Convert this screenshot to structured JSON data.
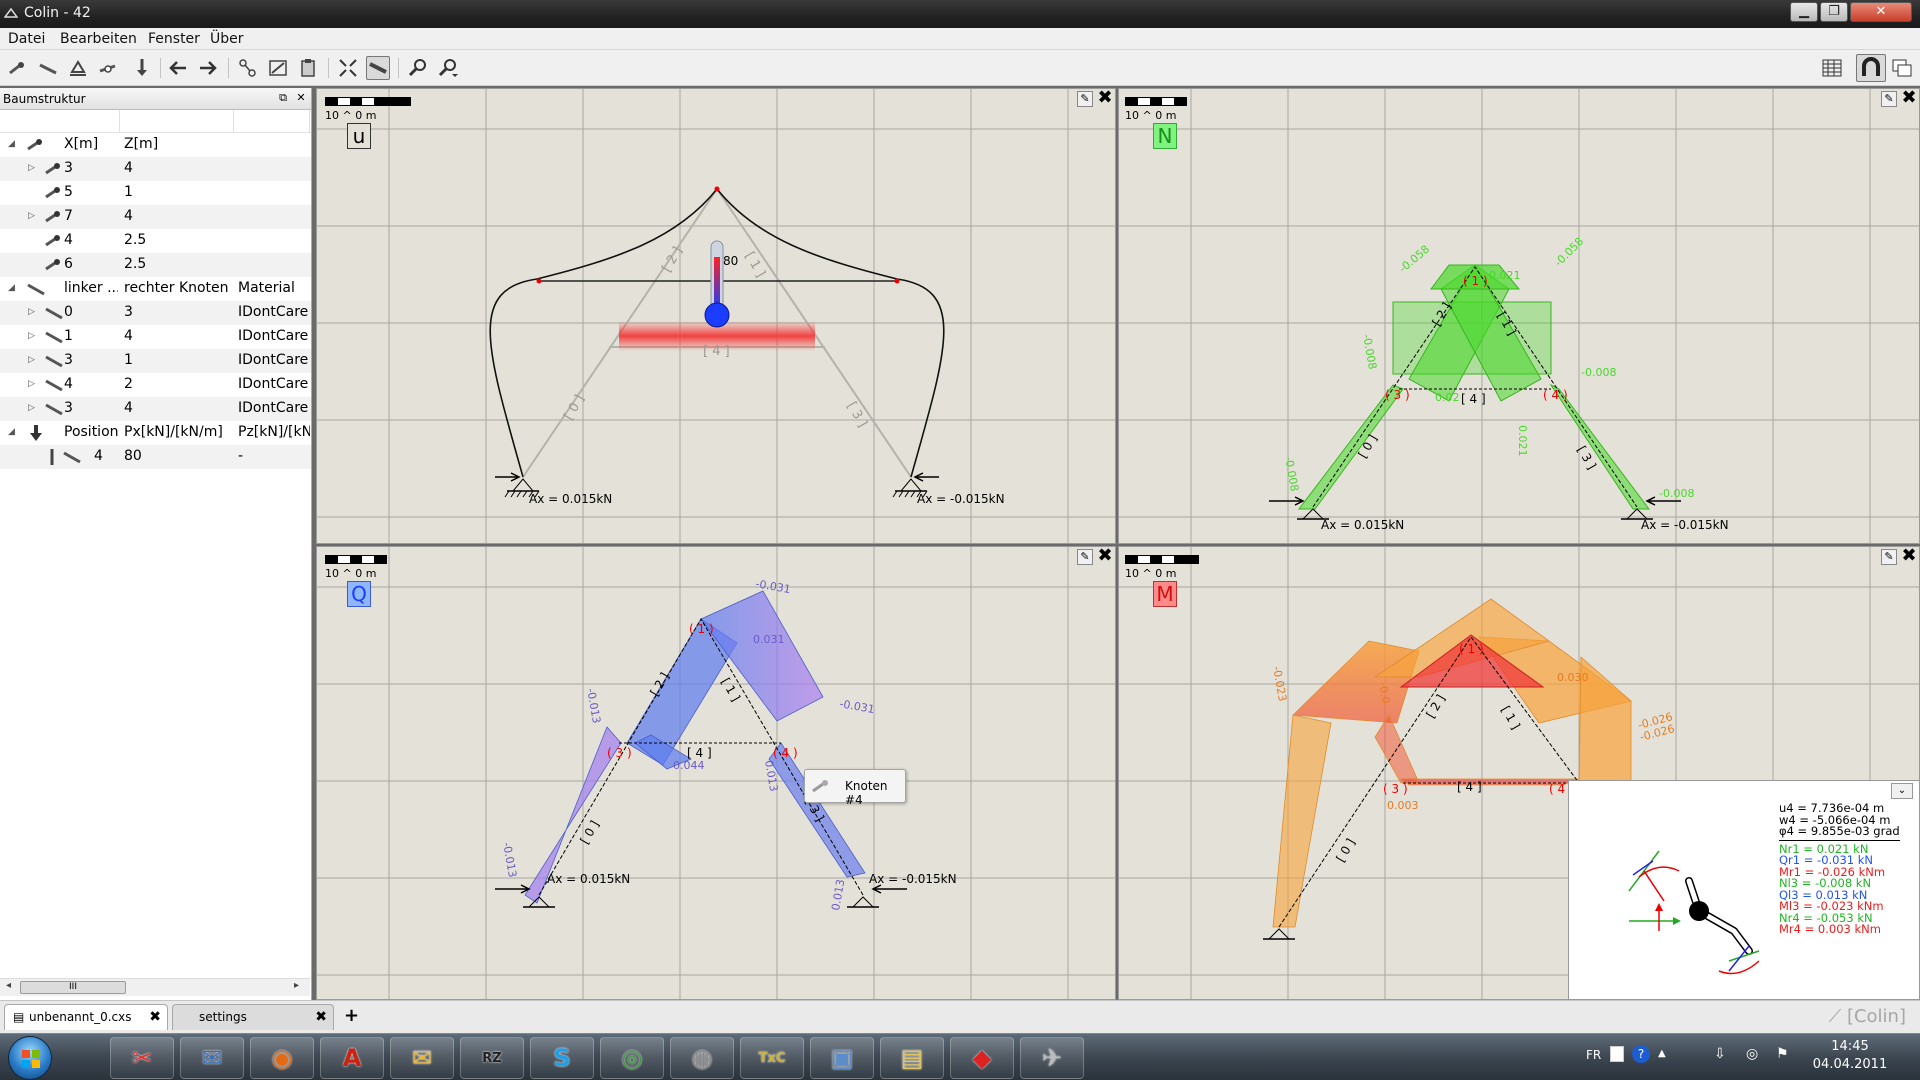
{
  "window": {
    "title": "Colin - 42",
    "min_icon": "minimize-icon",
    "max_icon": "maximize-icon",
    "close_icon": "close-icon"
  },
  "menu": [
    "Datei",
    "Bearbeiten",
    "Fenster",
    "Über"
  ],
  "toolbar": {
    "left_icons": [
      "node-tool-icon",
      "beam-tool-icon",
      "support-tool-icon",
      "hinge-tool-icon",
      "load-tool-icon",
      "undo-arrow-icon",
      "redo-arrow-icon",
      "cut-icon",
      "edit-icon",
      "paste-icon",
      "fit-view-icon",
      "ruler-icon",
      "zoom-in-icon",
      "zoom-out-icon"
    ],
    "right_icons": [
      "table-icon",
      "magnet-icon",
      "windows-icon"
    ]
  },
  "tree": {
    "header": "Baumstruktur",
    "nodes_section": {
      "col1": "X[m]",
      "col2": "Z[m]",
      "rows": [
        {
          "x": "3",
          "z": "4"
        },
        {
          "x": "5",
          "z": "1"
        },
        {
          "x": "7",
          "z": "4"
        },
        {
          "x": "4",
          "z": "2.5"
        },
        {
          "x": "6",
          "z": "2.5"
        }
      ]
    },
    "beams_section": {
      "col1": "linker ...",
      "col2": "rechter Knoten",
      "col3": "Material",
      "rows": [
        {
          "l": "0",
          "r": "3",
          "m": "IDontCare"
        },
        {
          "l": "1",
          "r": "4",
          "m": "IDontCare"
        },
        {
          "l": "3",
          "r": "1",
          "m": "IDontCare"
        },
        {
          "l": "4",
          "r": "2",
          "m": "IDontCare"
        },
        {
          "l": "3",
          "r": "4",
          "m": "IDontCare"
        }
      ]
    },
    "loads_section": {
      "col1": "Position",
      "col2": "Px[kN]/[kN/m]",
      "col3": "Pz[kN]/[kN/",
      "rows": [
        {
          "pos": "4",
          "px": "80",
          "pz": "-"
        }
      ]
    },
    "scroll_thumb": "III"
  },
  "views": {
    "scale_text": "10 ^ 0 m",
    "u": {
      "label": "u",
      "load": "80",
      "beam_labels": [
        "[ 2 ]",
        "[ 1 ]",
        "[ 4 ]",
        "[ 0 ]",
        "[ 3 ]"
      ],
      "reactions": [
        "Ax = 0.015kN",
        "Ax = -0.015kN"
      ]
    },
    "n": {
      "label": "N",
      "values": [
        "-0.058",
        "0.021",
        "-0.058",
        "-0.008",
        "-0.008",
        "0.02",
        "0.021",
        "-0.008",
        "-0.008"
      ],
      "nodes": [
        "( 1 )",
        "( 3 )",
        "( 4 )"
      ],
      "beams": [
        "[ 2 ]",
        "[ 1 ]",
        "[ 4 ]",
        "[ 0 ]",
        "[ 3 ]"
      ],
      "reactions": [
        "Ax = 0.015kN",
        "Ax = -0.015kN"
      ]
    },
    "q": {
      "label": "Q",
      "values": [
        "-0.031",
        "0.031",
        "-0.031",
        "-0.013",
        "0.044",
        "0.013",
        "-0.013",
        "0.013"
      ],
      "nodes": [
        "( 1 )",
        "( 3 )",
        "( 4 )"
      ],
      "beams": [
        "[ 2 ]",
        "[ 1 ]",
        "[ 4 ]",
        "[ 0 ]",
        "[ 3 ]"
      ],
      "reactions": [
        "Ax = 0.015kN",
        "Ax = -0.015kN"
      ],
      "tooltip": "Knoten #4"
    },
    "m": {
      "label": "M",
      "values": [
        "0.030",
        "-0.026",
        "-0.026",
        "-0.023",
        "0.003",
        "-0.0"
      ],
      "nodes": [
        "( 1 )",
        "( 3 )",
        "( 4"
      ],
      "beams": [
        "[ 2 ]",
        "[ 1 ]",
        "[ 4 ]",
        "[ 0 ]"
      ]
    }
  },
  "infobox": {
    "lines": [
      {
        "text": "u4 = 7.736e-04 m",
        "color": "#000000"
      },
      {
        "text": "w4 = -5.066e-04 m",
        "color": "#000000"
      },
      {
        "text": "φ4 = 9.855e-03 grad",
        "color": "#000000"
      },
      {
        "text": "Nr1 = 0.021 kN",
        "color": "#22b522"
      },
      {
        "text": "Qr1 = -0.031 kN",
        "color": "#2255ee"
      },
      {
        "text": "Mr1 = -0.026 kNm",
        "color": "#ee1c1c"
      },
      {
        "text": "Nl3 = -0.008 kN",
        "color": "#22b522"
      },
      {
        "text": "Ql3 = 0.013 kN",
        "color": "#2255ee"
      },
      {
        "text": "Ml3 = -0.023 kNm",
        "color": "#ee1c1c"
      },
      {
        "text": "Nr4 = -0.053 kN",
        "color": "#22b522"
      },
      {
        "text": "Mr4 = 0.003 kNm",
        "color": "#ee1c1c"
      }
    ]
  },
  "tabs": [
    {
      "label": "unbenannt_0.cxs"
    },
    {
      "label": "settings"
    }
  ],
  "status_right": "[Colin]",
  "taskbar": {
    "apps": [
      "snipping-icon",
      "thunderbird-icon",
      "firefox-icon",
      "acrobat-reader-icon",
      "outlook-icon",
      "rz-icon",
      "skype-icon",
      "chrome-icon",
      "media-icon",
      "txc-icon",
      "photo-icon",
      "explorer-icon",
      "pdf-icon",
      "colin-icon"
    ],
    "lang": "FR",
    "time": "14:45",
    "date": "04.04.2011"
  },
  "colors": {
    "n_green": "#48d82a",
    "q_blue": "#5b7cf0",
    "q_violet": "#b07ef0",
    "m_red": "#f03a3a",
    "m_orange": "#f8a33c",
    "grid": "#a7a7a0",
    "canvas": "#e4e2d8"
  }
}
